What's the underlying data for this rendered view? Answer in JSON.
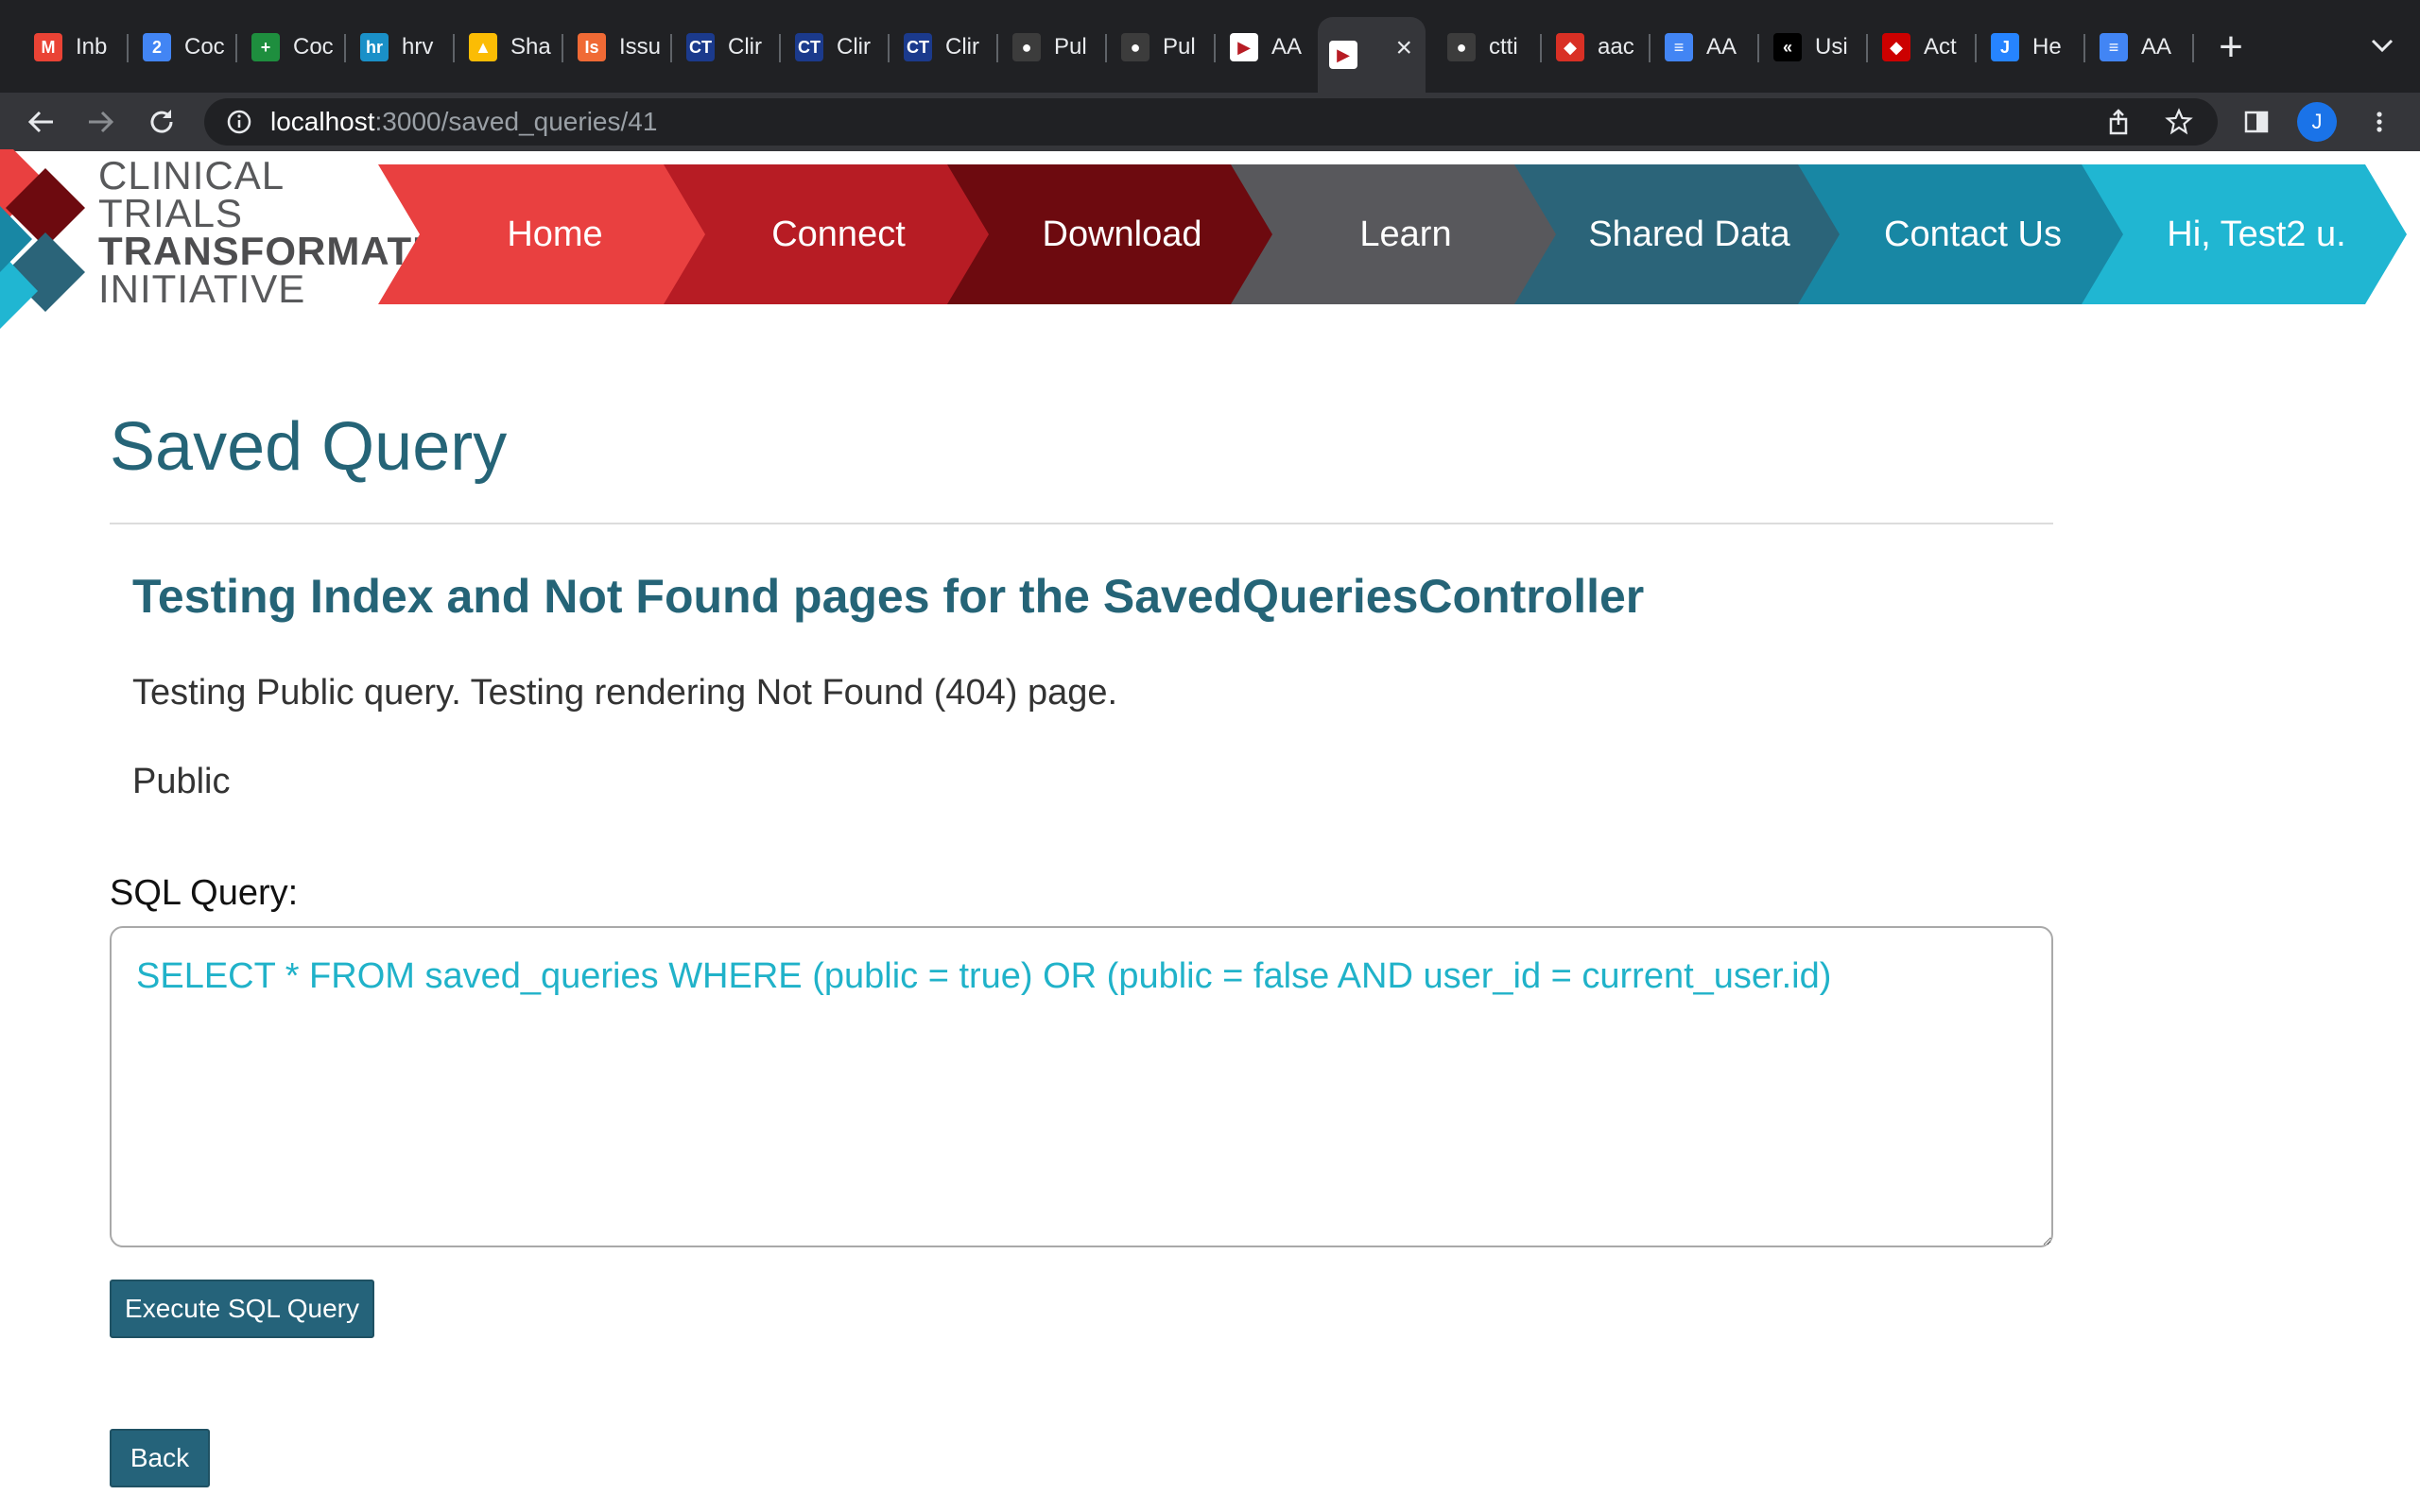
{
  "browser": {
    "tabs": [
      {
        "label": "Inb",
        "icon": "gmail-icon",
        "color": "#ea4335",
        "glyph": "M"
      },
      {
        "label": "Coc",
        "icon": "calendar-icon",
        "color": "#4285f4",
        "glyph": "2"
      },
      {
        "label": "Coc",
        "icon": "code-icon",
        "color": "#1e8e3e",
        "glyph": "+"
      },
      {
        "label": "hrv",
        "icon": "hr-icon",
        "color": "#1a90c8",
        "glyph": "hr"
      },
      {
        "label": "Sha",
        "icon": "drive-icon",
        "color": "#fbbc04",
        "glyph": "▲"
      },
      {
        "label": "Issu",
        "icon": "issues-icon",
        "color": "#f06a35",
        "glyph": "Is"
      },
      {
        "label": "Clir",
        "icon": "ct-icon",
        "color": "#1b3a8c",
        "glyph": "CT"
      },
      {
        "label": "Clir",
        "icon": "ct-icon",
        "color": "#1b3a8c",
        "glyph": "CT"
      },
      {
        "label": "Clir",
        "icon": "ct-icon",
        "color": "#1b3a8c",
        "glyph": "CT"
      },
      {
        "label": "Pul",
        "icon": "github-icon",
        "color": "#3c3c3c",
        "glyph": "●"
      },
      {
        "label": "Pul",
        "icon": "github-icon",
        "color": "#3c3c3c",
        "glyph": "●"
      },
      {
        "label": "AA",
        "icon": "ctti-icon",
        "color": "#ffffff",
        "glyph": "▶"
      },
      {
        "label": "",
        "icon": "ctti-icon",
        "color": "#ffffff",
        "glyph": "▶",
        "active": true
      },
      {
        "label": "ctti",
        "icon": "github-icon",
        "color": "#3c3c3c",
        "glyph": "●"
      },
      {
        "label": "aac",
        "icon": "app-icon",
        "color": "#d93025",
        "glyph": "◆"
      },
      {
        "label": "AA",
        "icon": "docs-icon",
        "color": "#4285f4",
        "glyph": "≡"
      },
      {
        "label": "Usi",
        "icon": "chevrons-icon",
        "color": "#000000",
        "glyph": "«"
      },
      {
        "label": "Act",
        "icon": "ruby-icon",
        "color": "#cc0000",
        "glyph": "◆"
      },
      {
        "label": "He",
        "icon": "jira-icon",
        "color": "#2684ff",
        "glyph": "J"
      },
      {
        "label": "AA",
        "icon": "docs-icon",
        "color": "#4285f4",
        "glyph": "≡"
      }
    ],
    "url_host": "localhost",
    "url_path": ":3000/saved_queries/41",
    "profile_initial": "J"
  },
  "logo": {
    "line1": "CLINICAL",
    "line2": "TRIALS",
    "line3": "TRANSFORMATION",
    "line4": "INITIATIVE"
  },
  "nav": [
    {
      "label": "Home",
      "color": "#e94040"
    },
    {
      "label": "Connect",
      "color": "#b71c24"
    },
    {
      "label": "Download",
      "color": "#6d0a0f"
    },
    {
      "label": "Learn",
      "color": "#58585c"
    },
    {
      "label": "Shared Data",
      "color": "#2b6479"
    },
    {
      "label": "Contact Us",
      "color": "#1887a4"
    },
    {
      "label": "Hi, Test2 u.",
      "color": "#20b6d2"
    }
  ],
  "page": {
    "title": "Saved Query",
    "query_name": "Testing Index and Not Found pages for the SavedQueriesController",
    "description": "Testing Public query. Testing rendering Not Found (404) page.",
    "visibility": "Public",
    "sql_label": "SQL Query:",
    "sql_value": "SELECT * FROM saved_queries WHERE (public = true) OR (public = false AND user_id = current_user.id)",
    "execute_label": "Execute SQL Query",
    "back_label": "Back"
  }
}
